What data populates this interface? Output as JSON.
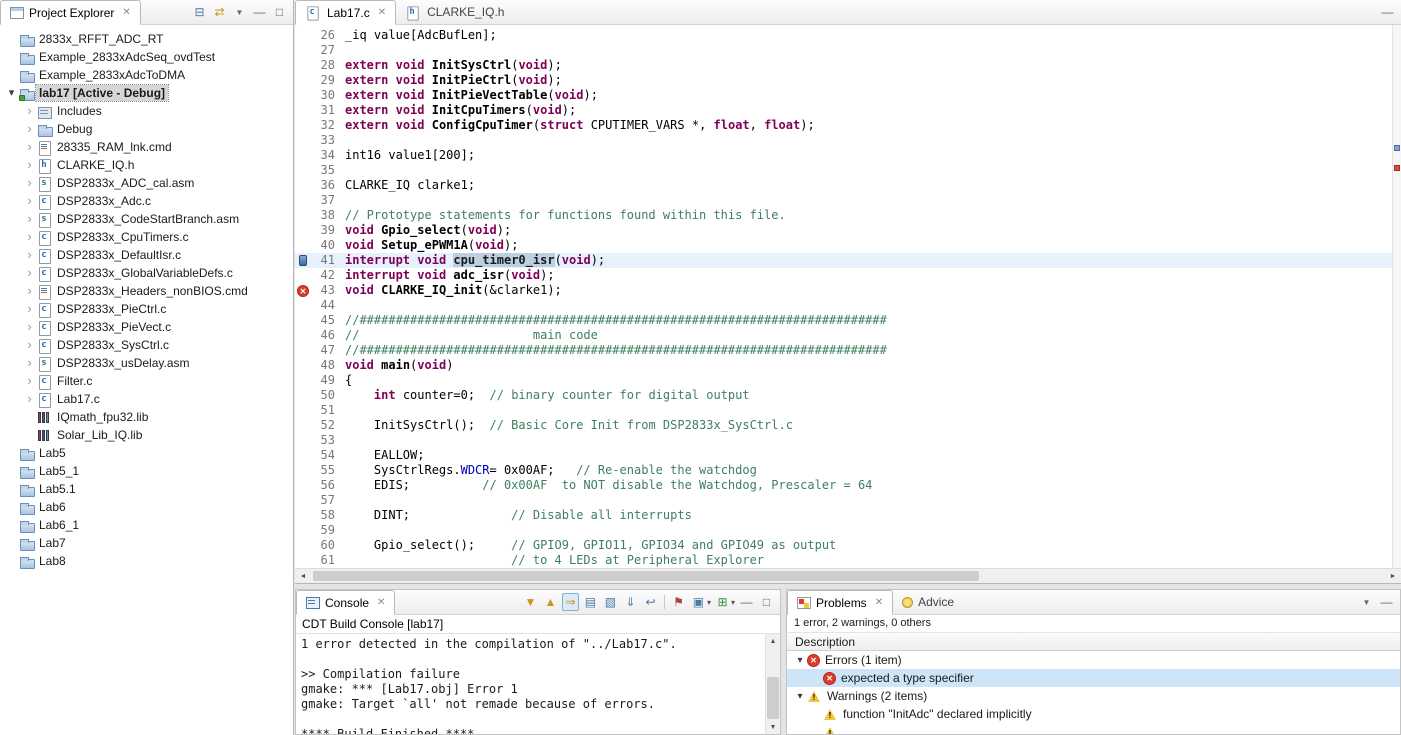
{
  "glyphs": {
    "close": "✕",
    "minimize": "—",
    "maximize": "□",
    "view_menu": "▼",
    "collapse_all": "⊟",
    "link_editor": "⇄",
    "next_error": "▼",
    "prev_error": "▲",
    "show_error": "⇒",
    "copy_log": "▤",
    "clear_console": "▧",
    "scroll_lock": "⇓",
    "word_wrap": "↩",
    "pin_console": "⚑",
    "display_console": "▣",
    "open_console": "⊞",
    "caret_down": "▾",
    "left_arrow": "◄",
    "right_arrow": "►",
    "up_arrow": "▲",
    "down_arrow": "▼",
    "warning_mark": "!",
    "file_c": "c",
    "file_h": "h",
    "file_s": "s"
  },
  "project_explorer": {
    "title": "Project Explorer",
    "items": [
      {
        "label": "2833x_RFFT_ADC_RT",
        "icon": "folder",
        "depth": 0
      },
      {
        "label": "Example_2833xAdcSeq_ovdTest",
        "icon": "folder",
        "depth": 0
      },
      {
        "label": "Example_2833xAdcToDMA",
        "icon": "folder",
        "depth": 0
      },
      {
        "label": "lab17 [Active - Debug]",
        "icon": "project-active",
        "depth": 0,
        "expanded": true,
        "selected": true
      },
      {
        "label": "Includes",
        "icon": "includes",
        "depth": 1,
        "chevron": true
      },
      {
        "label": "Debug",
        "icon": "folder",
        "depth": 1,
        "chevron": true
      },
      {
        "label": "28335_RAM_lnk.cmd",
        "icon": "file-cmd",
        "depth": 1,
        "chevron": true
      },
      {
        "label": "CLARKE_IQ.h",
        "icon": "file-h",
        "depth": 1,
        "chevron": true
      },
      {
        "label": "DSP2833x_ADC_cal.asm",
        "icon": "file-asm",
        "depth": 1,
        "chevron": true
      },
      {
        "label": "DSP2833x_Adc.c",
        "icon": "file-c",
        "depth": 1,
        "chevron": true
      },
      {
        "label": "DSP2833x_CodeStartBranch.asm",
        "icon": "file-asm",
        "depth": 1,
        "chevron": true
      },
      {
        "label": "DSP2833x_CpuTimers.c",
        "icon": "file-c",
        "depth": 1,
        "chevron": true
      },
      {
        "label": "DSP2833x_DefaultIsr.c",
        "icon": "file-c",
        "depth": 1,
        "chevron": true
      },
      {
        "label": "DSP2833x_GlobalVariableDefs.c",
        "icon": "file-c",
        "depth": 1,
        "chevron": true
      },
      {
        "label": "DSP2833x_Headers_nonBIOS.cmd",
        "icon": "file-cmd",
        "depth": 1,
        "chevron": true
      },
      {
        "label": "DSP2833x_PieCtrl.c",
        "icon": "file-c",
        "depth": 1,
        "chevron": true
      },
      {
        "label": "DSP2833x_PieVect.c",
        "icon": "file-c",
        "depth": 1,
        "chevron": true
      },
      {
        "label": "DSP2833x_SysCtrl.c",
        "icon": "file-c",
        "depth": 1,
        "chevron": true
      },
      {
        "label": "DSP2833x_usDelay.asm",
        "icon": "file-asm",
        "depth": 1,
        "chevron": true
      },
      {
        "label": "Filter.c",
        "icon": "file-c",
        "depth": 1,
        "chevron": true
      },
      {
        "label": "Lab17.c",
        "icon": "file-c",
        "depth": 1,
        "chevron": true
      },
      {
        "label": "IQmath_fpu32.lib",
        "icon": "lib",
        "depth": 1
      },
      {
        "label": "Solar_Lib_IQ.lib",
        "icon": "lib",
        "depth": 1
      },
      {
        "label": "Lab5",
        "icon": "folder",
        "depth": 0
      },
      {
        "label": "Lab5_1",
        "icon": "folder",
        "depth": 0
      },
      {
        "label": "Lab5.1",
        "icon": "folder",
        "depth": 0
      },
      {
        "label": "Lab6",
        "icon": "folder",
        "depth": 0
      },
      {
        "label": "Lab6_1",
        "icon": "folder",
        "depth": 0
      },
      {
        "label": "Lab7",
        "icon": "folder",
        "depth": 0
      },
      {
        "label": "Lab8",
        "icon": "folder",
        "depth": 0
      }
    ]
  },
  "editor": {
    "tabs": [
      {
        "label": "Lab17.c",
        "active": true
      },
      {
        "label": "CLARKE_IQ.h",
        "active": false
      }
    ],
    "lines": [
      {
        "no": 26,
        "segs": [
          [
            "p",
            "_iq value[AdcBufLen];"
          ]
        ]
      },
      {
        "no": 27,
        "segs": []
      },
      {
        "no": 28,
        "segs": [
          [
            "k",
            "extern"
          ],
          [
            "p",
            " "
          ],
          [
            "k",
            "void"
          ],
          [
            "p",
            " "
          ],
          [
            "fn",
            "InitSysCtrl"
          ],
          [
            "p",
            "("
          ],
          [
            "k",
            "void"
          ],
          [
            "p",
            ");"
          ]
        ]
      },
      {
        "no": 29,
        "segs": [
          [
            "k",
            "extern"
          ],
          [
            "p",
            " "
          ],
          [
            "k",
            "void"
          ],
          [
            "p",
            " "
          ],
          [
            "fn",
            "InitPieCtrl"
          ],
          [
            "p",
            "("
          ],
          [
            "k",
            "void"
          ],
          [
            "p",
            ");"
          ]
        ]
      },
      {
        "no": 30,
        "segs": [
          [
            "k",
            "extern"
          ],
          [
            "p",
            " "
          ],
          [
            "k",
            "void"
          ],
          [
            "p",
            " "
          ],
          [
            "fn",
            "InitPieVectTable"
          ],
          [
            "p",
            "("
          ],
          [
            "k",
            "void"
          ],
          [
            "p",
            ");"
          ]
        ]
      },
      {
        "no": 31,
        "segs": [
          [
            "k",
            "extern"
          ],
          [
            "p",
            " "
          ],
          [
            "k",
            "void"
          ],
          [
            "p",
            " "
          ],
          [
            "fn",
            "InitCpuTimers"
          ],
          [
            "p",
            "("
          ],
          [
            "k",
            "void"
          ],
          [
            "p",
            ");"
          ]
        ]
      },
      {
        "no": 32,
        "segs": [
          [
            "k",
            "extern"
          ],
          [
            "p",
            " "
          ],
          [
            "k",
            "void"
          ],
          [
            "p",
            " "
          ],
          [
            "fn",
            "ConfigCpuTimer"
          ],
          [
            "p",
            "("
          ],
          [
            "k",
            "struct"
          ],
          [
            "p",
            " CPUTIMER_VARS *, "
          ],
          [
            "k",
            "float"
          ],
          [
            "p",
            ", "
          ],
          [
            "k",
            "float"
          ],
          [
            "p",
            ");"
          ]
        ]
      },
      {
        "no": 33,
        "segs": []
      },
      {
        "no": 34,
        "segs": [
          [
            "p",
            "int16 value1[200];"
          ]
        ]
      },
      {
        "no": 35,
        "segs": []
      },
      {
        "no": 36,
        "segs": [
          [
            "p",
            "CLARKE_IQ clarke1;"
          ]
        ]
      },
      {
        "no": 37,
        "segs": []
      },
      {
        "no": 38,
        "segs": [
          [
            "c",
            "// Prototype statements for functions found within this file."
          ]
        ]
      },
      {
        "no": 39,
        "segs": [
          [
            "k",
            "void"
          ],
          [
            "p",
            " "
          ],
          [
            "fn",
            "Gpio_select"
          ],
          [
            "p",
            "("
          ],
          [
            "k",
            "void"
          ],
          [
            "p",
            ");"
          ]
        ]
      },
      {
        "no": 40,
        "segs": [
          [
            "k",
            "void"
          ],
          [
            "p",
            " "
          ],
          [
            "fn",
            "Setup_ePWM1A"
          ],
          [
            "p",
            "("
          ],
          [
            "k",
            "void"
          ],
          [
            "p",
            ");"
          ]
        ]
      },
      {
        "no": 41,
        "highlight": true,
        "marker": "bookmark",
        "segs": [
          [
            "k",
            "interrupt"
          ],
          [
            "p",
            " "
          ],
          [
            "k",
            "void"
          ],
          [
            "p",
            " "
          ],
          [
            "sel",
            "cpu_timer0_isr"
          ],
          [
            "p",
            "("
          ],
          [
            "k",
            "void"
          ],
          [
            "p",
            ");"
          ]
        ]
      },
      {
        "no": 42,
        "segs": [
          [
            "k",
            "interrupt"
          ],
          [
            "p",
            " "
          ],
          [
            "k",
            "void"
          ],
          [
            "p",
            " "
          ],
          [
            "fn",
            "adc_isr"
          ],
          [
            "p",
            "("
          ],
          [
            "k",
            "void"
          ],
          [
            "p",
            ");"
          ]
        ]
      },
      {
        "no": 43,
        "marker": "error",
        "segs": [
          [
            "k",
            "void"
          ],
          [
            "p",
            " "
          ],
          [
            "fn",
            "CLARKE_IQ_init"
          ],
          [
            "p",
            "(&clarke1);"
          ]
        ]
      },
      {
        "no": 44,
        "segs": []
      },
      {
        "no": 45,
        "segs": [
          [
            "c",
            "//#########################################################################"
          ]
        ]
      },
      {
        "no": 46,
        "segs": [
          [
            "c",
            "//                        main code"
          ]
        ]
      },
      {
        "no": 47,
        "segs": [
          [
            "c",
            "//#########################################################################"
          ]
        ]
      },
      {
        "no": 48,
        "segs": [
          [
            "k",
            "void"
          ],
          [
            "p",
            " "
          ],
          [
            "fn",
            "main"
          ],
          [
            "p",
            "("
          ],
          [
            "k",
            "void"
          ],
          [
            "p",
            ")"
          ]
        ]
      },
      {
        "no": 49,
        "segs": [
          [
            "p",
            "{"
          ]
        ]
      },
      {
        "no": 50,
        "segs": [
          [
            "p",
            "    "
          ],
          [
            "k",
            "int"
          ],
          [
            "p",
            " counter=0;  "
          ],
          [
            "c",
            "// binary counter for digital output"
          ]
        ]
      },
      {
        "no": 51,
        "segs": []
      },
      {
        "no": 52,
        "segs": [
          [
            "p",
            "    InitSysCtrl();  "
          ],
          [
            "c",
            "// Basic Core Init from DSP2833x_SysCtrl.c"
          ]
        ]
      },
      {
        "no": 53,
        "segs": []
      },
      {
        "no": 54,
        "segs": [
          [
            "p",
            "    EALLOW;"
          ]
        ]
      },
      {
        "no": 55,
        "segs": [
          [
            "p",
            "    SysCtrlRegs."
          ],
          [
            "fld",
            "WDCR"
          ],
          [
            "p",
            "= 0x00AF;   "
          ],
          [
            "c",
            "// Re-enable the watchdog"
          ]
        ]
      },
      {
        "no": 56,
        "segs": [
          [
            "p",
            "    EDIS;          "
          ],
          [
            "c",
            "// 0x00AF  to NOT disable the Watchdog, Prescaler = 64"
          ]
        ]
      },
      {
        "no": 57,
        "segs": []
      },
      {
        "no": 58,
        "segs": [
          [
            "p",
            "    DINT;              "
          ],
          [
            "c",
            "// Disable all interrupts"
          ]
        ]
      },
      {
        "no": 59,
        "segs": []
      },
      {
        "no": 60,
        "segs": [
          [
            "p",
            "    Gpio_select();     "
          ],
          [
            "c",
            "// GPIO9, GPIO11, GPIO34 and GPIO49 as output"
          ]
        ]
      },
      {
        "no": 61,
        "segs": [
          [
            "p",
            "                       "
          ],
          [
            "c",
            "// to 4 LEDs at Peripheral Explorer"
          ]
        ]
      }
    ]
  },
  "console": {
    "tab_label": "Console",
    "subtitle": "CDT Build Console [lab17]",
    "lines": [
      "1 error detected in the compilation of \"../Lab17.c\".",
      "",
      ">> Compilation failure",
      "gmake: *** [Lab17.obj] Error 1",
      "gmake: Target `all' not remade because of errors.",
      "",
      "**** Build Finished ****"
    ]
  },
  "problems": {
    "tab_problems": "Problems",
    "tab_advice": "Advice",
    "summary": "1 error, 2 warnings, 0 others",
    "column_header": "Description",
    "rows": [
      {
        "name": "errors-group",
        "type": "group",
        "icon": "error",
        "label": "Errors (1 item)",
        "expanded": true
      },
      {
        "name": "error-item",
        "type": "item",
        "icon": "error",
        "label": "expected a type specifier",
        "selected": true
      },
      {
        "name": "warnings-group",
        "type": "group",
        "icon": "warning",
        "label": "Warnings (2 items)",
        "expanded": true
      },
      {
        "name": "warning-item",
        "type": "item",
        "icon": "warning",
        "label": "function \"InitAdc\" declared implicitly"
      },
      {
        "name": "warning-item-partial",
        "type": "item",
        "icon": "warning",
        "label": "",
        "partial": true
      }
    ]
  }
}
